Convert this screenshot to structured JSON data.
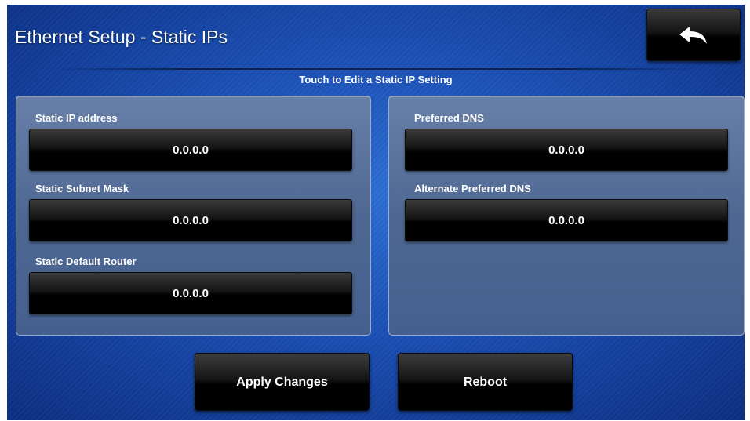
{
  "header": {
    "title": "Ethernet Setup - Static IPs",
    "back_icon": "back-arrow-icon"
  },
  "instruction": "Touch to Edit a Static IP Setting",
  "left_panel": {
    "fields": [
      {
        "label": "Static IP address",
        "value": "0.0.0.0"
      },
      {
        "label": "Static Subnet Mask",
        "value": "0.0.0.0"
      },
      {
        "label": "Static Default Router",
        "value": "0.0.0.0"
      }
    ]
  },
  "right_panel": {
    "fields": [
      {
        "label": "Preferred DNS",
        "value": "0.0.0.0"
      },
      {
        "label": "Alternate Preferred DNS",
        "value": "0.0.0.0"
      }
    ]
  },
  "actions": {
    "apply_label": "Apply Changes",
    "reboot_label": "Reboot"
  },
  "colors": {
    "background": "#1b4fb4",
    "panel": "#4f6893",
    "button": "#000000",
    "text": "#ffffff"
  }
}
